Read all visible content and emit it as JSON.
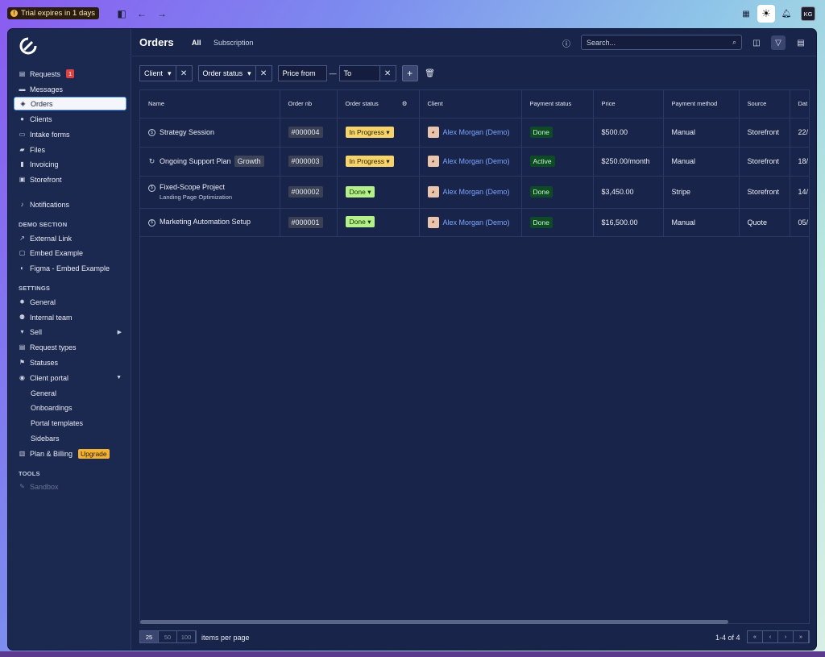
{
  "topbar": {
    "trial": "Trial expires in 1 days",
    "avatar": "KG"
  },
  "sidebar": {
    "items": [
      {
        "label": "Requests",
        "icon": "inbox-icon",
        "badge": "1"
      },
      {
        "label": "Messages",
        "icon": "message-icon"
      },
      {
        "label": "Orders",
        "icon": "box-icon",
        "active": true
      },
      {
        "label": "Clients",
        "icon": "user-icon"
      },
      {
        "label": "Intake forms",
        "icon": "form-icon"
      },
      {
        "label": "Files",
        "icon": "folder-icon"
      },
      {
        "label": "Invoicing",
        "icon": "invoice-icon"
      },
      {
        "label": "Storefront",
        "icon": "store-icon"
      },
      {
        "label": "Notifications",
        "icon": "bell-icon"
      }
    ],
    "demo_section": "DEMO SECTION",
    "demo_items": [
      {
        "label": "External Link",
        "icon": "external-link-icon"
      },
      {
        "label": "Embed Example",
        "icon": "embed-icon"
      },
      {
        "label": "Figma - Embed Example",
        "icon": "figma-icon"
      }
    ],
    "settings_section": "SETTINGS",
    "settings_items": [
      {
        "label": "General",
        "icon": "gear-icon"
      },
      {
        "label": "Internal team",
        "icon": "team-icon"
      },
      {
        "label": "Sell",
        "icon": "cart-icon"
      },
      {
        "label": "Request types",
        "icon": "request-type-icon"
      },
      {
        "label": "Statuses",
        "icon": "flag-icon"
      },
      {
        "label": "Client portal",
        "icon": "portal-icon"
      }
    ],
    "portal_sub": [
      "General",
      "Onboardings",
      "Portal templates",
      "Sidebars"
    ],
    "billing": {
      "label": "Plan & Billing",
      "upgrade": "Upgrade"
    },
    "tools_section": "TOOLS",
    "sandbox": "Sandbox"
  },
  "header": {
    "title": "Orders",
    "tabs": [
      "All",
      "Subscription"
    ],
    "search_placeholder": "Search..."
  },
  "filters": {
    "client": "Client",
    "order_status": "Order status",
    "price_from": "Price from",
    "to": "To",
    "dash": "—"
  },
  "table": {
    "columns": [
      "Name",
      "Order nb",
      "Order status",
      "Client",
      "Payment status",
      "Price",
      "Payment method",
      "Source",
      "Dat"
    ],
    "rows": [
      {
        "name": "Strategy Session",
        "tag": "",
        "subtitle": "",
        "order": "#000004",
        "status": "In Progress",
        "client": "Alex Morgan (Demo)",
        "payment": "Done",
        "price": "$500.00",
        "method": "Manual",
        "source": "Storefront",
        "date": "22/"
      },
      {
        "name": "Ongoing Support Plan",
        "tag": "Growth",
        "subtitle": "",
        "order": "#000003",
        "status": "In Progress",
        "client": "Alex Morgan (Demo)",
        "payment": "Active",
        "price": "$250.00/month",
        "method": "Manual",
        "source": "Storefront",
        "date": "18/"
      },
      {
        "name": "Fixed-Scope Project",
        "tag": "",
        "subtitle": "Landing Page Optimization",
        "order": "#000002",
        "status": "Done",
        "client": "Alex Morgan (Demo)",
        "payment": "Done",
        "price": "$3,450.00",
        "method": "Stripe",
        "source": "Storefront",
        "date": "14/"
      },
      {
        "name": "Marketing Automation Setup",
        "tag": "",
        "subtitle": "",
        "order": "#000001",
        "status": "Done",
        "client": "Alex Morgan (Demo)",
        "payment": "Done",
        "price": "$16,500.00",
        "method": "Manual",
        "source": "Quote",
        "date": "05/"
      }
    ]
  },
  "footer": {
    "per_page": [
      "25",
      "50",
      "100"
    ],
    "items_per_page": "items per page",
    "range": "1-4 of 4"
  }
}
